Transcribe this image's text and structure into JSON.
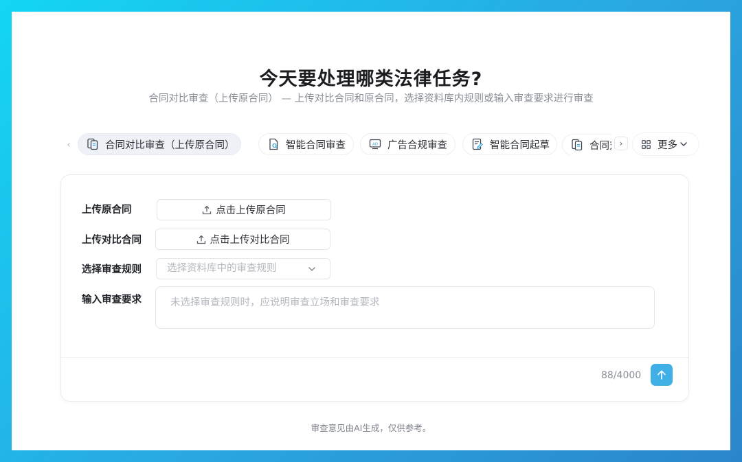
{
  "page": {
    "title": "今天要处理哪类法律任务?",
    "subtitle": "合同对比审查（上传原合同） — 上传对比合同和原合同，选择资料库内规则或输入审查要求进行审查",
    "footer_note": "审查意见由AI生成，仅供参考。"
  },
  "tabs": [
    {
      "label": "合同对比审查（上传原合同）",
      "icon": "contract-compare-icon",
      "active": true
    },
    {
      "label": "智能合同审查",
      "icon": "contract-review-icon",
      "active": false
    },
    {
      "label": "广告合规审查",
      "icon": "ad-compliance-icon",
      "active": false
    },
    {
      "label": "智能合同起草",
      "icon": "contract-draft-icon",
      "active": false
    },
    {
      "label": "合同对比审查",
      "icon": "contract-compare-icon",
      "active": false
    }
  ],
  "more": {
    "label": "更多",
    "icon": "grid-icon"
  },
  "form": {
    "upload_original": {
      "label": "上传原合同",
      "button": "点击上传原合同"
    },
    "upload_compare": {
      "label": "上传对比合同",
      "button": "点击上传对比合同"
    },
    "rule_select": {
      "label": "选择审查规则",
      "placeholder": "选择资料库中的审查规则"
    },
    "requirement": {
      "label": "输入审查要求",
      "placeholder": "未选择审查规则时，应说明审查立场和审查要求"
    },
    "counter": "88/4000"
  },
  "colors": {
    "accent": "#3fb0e6",
    "frame_gradient_start": "#13d6f4",
    "frame_gradient_end": "#2b86c9",
    "active_tab_bg": "#eef1f6"
  }
}
